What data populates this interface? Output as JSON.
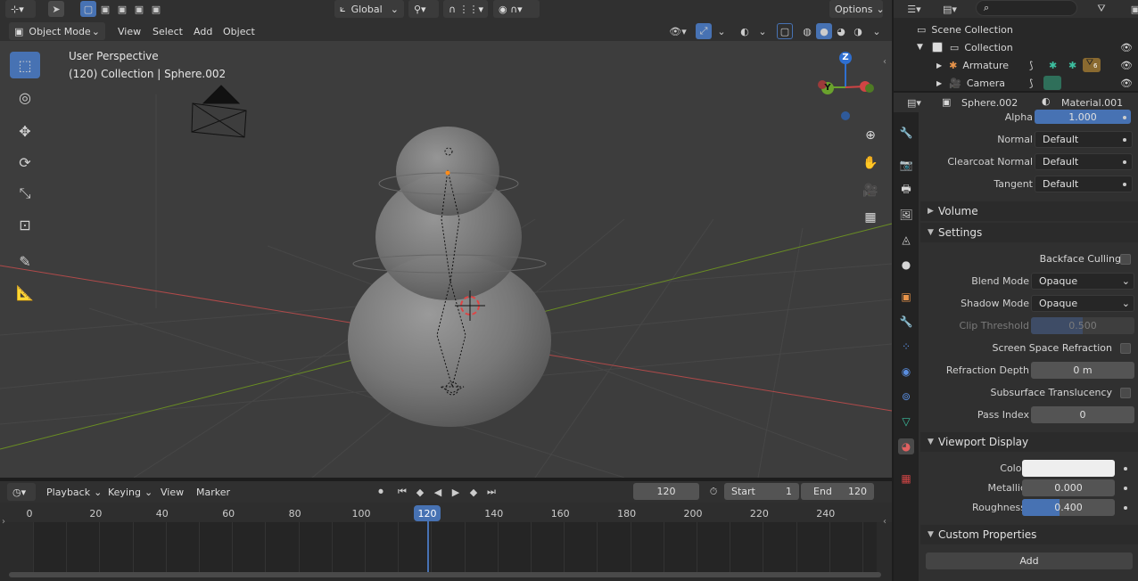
{
  "viewport_header": {
    "transform_orientation": "Global",
    "options_label": "Options",
    "mode_label": "Object Mode",
    "menus": [
      "View",
      "Select",
      "Add",
      "Object"
    ]
  },
  "viewport": {
    "perspective_label": "User Perspective",
    "collection_label": "(120) Collection | Sphere.002",
    "gizmo_axis_z": "Z",
    "gizmo_axis_y": "Y"
  },
  "outliner": {
    "search_placeholder": "",
    "scene_collection": "Scene Collection",
    "items": [
      {
        "label": "Collection"
      },
      {
        "label": "Armature"
      },
      {
        "label": "Camera"
      }
    ],
    "modifier_count": "6"
  },
  "properties": {
    "object_name": "Sphere.002",
    "material_name": "Material.001",
    "alpha_label": "Alpha",
    "alpha_value": "1.000",
    "normal_label": "Normal",
    "normal_value": "Default",
    "clearcoat_label": "Clearcoat Normal",
    "clearcoat_value": "Default",
    "tangent_label": "Tangent",
    "tangent_value": "Default",
    "volume_panel": "Volume",
    "settings_panel": "Settings",
    "backface_label": "Backface Culling",
    "blend_mode_label": "Blend Mode",
    "blend_mode_value": "Opaque",
    "shadow_mode_label": "Shadow Mode",
    "shadow_mode_value": "Opaque",
    "clip_threshold_label": "Clip Threshold",
    "clip_threshold_value": "0.500",
    "ssr_label": "Screen Space Refraction",
    "refraction_depth_label": "Refraction Depth",
    "refraction_depth_value": "0 m",
    "subsurface_label": "Subsurface Translucency",
    "pass_index_label": "Pass Index",
    "pass_index_value": "0",
    "viewport_display_panel": "Viewport Display",
    "color_label": "Color",
    "metallic_label": "Metallic",
    "metallic_value": "0.000",
    "roughness_label": "Roughness",
    "roughness_value": "0.400",
    "roughness_fraction": 0.4,
    "custom_props_panel": "Custom Properties",
    "add_label": "Add"
  },
  "timeline_header": {
    "playback_label": "Playback",
    "keying_label": "Keying",
    "view_label": "View",
    "marker_label": "Marker",
    "current_frame": "120",
    "start_label": "Start",
    "start_value": "1",
    "end_label": "End",
    "end_value": "120"
  },
  "timeline": {
    "ticks": [
      "0",
      "20",
      "40",
      "60",
      "80",
      "100",
      "120",
      "140",
      "160",
      "180",
      "200",
      "220",
      "240"
    ],
    "current_frame_marker": "120"
  },
  "colors": {
    "accent_blue": "#4772b3",
    "selected_blue": "#4b6ea8",
    "x_axis": "#b04a4a",
    "y_axis": "#6a8e23",
    "gizmo_z": "#2f6fd0",
    "gizmo_y": "#6aa22d",
    "gizmo_x": "#d04444"
  }
}
